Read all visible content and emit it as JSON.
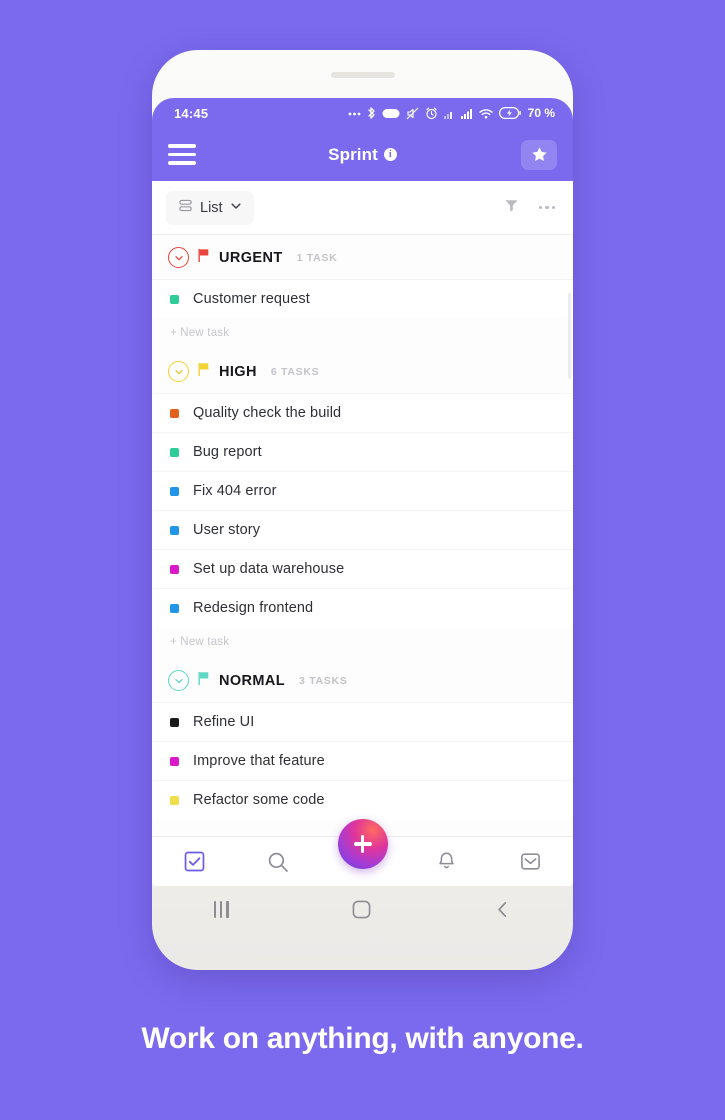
{
  "colors": {
    "background": "#7B6AEE",
    "header": "#7B6AEE",
    "urgent": "#E8453C",
    "high": "#F3D233",
    "normal": "#5FD6C4",
    "accent": "#7B6AEE"
  },
  "status_bar": {
    "time": "14:45",
    "battery_percent": "70 %",
    "icons": [
      "ellipsis-icon",
      "bluetooth-icon",
      "capsule-icon",
      "mute-icon",
      "alarm-icon",
      "signal-bars-icon",
      "signal-bars-2-icon",
      "wifi-icon",
      "battery-charging-icon"
    ]
  },
  "header": {
    "menu_icon": "hamburger-icon",
    "title": "Sprint",
    "info_badge": "i",
    "star_icon": "star-icon"
  },
  "toolbar": {
    "view_icon": "list-rows-icon",
    "view_label": "List",
    "chevron_icon": "chevron-down-icon",
    "filter_icon": "filter-funnel-icon",
    "more_icon": "more-dots-icon"
  },
  "new_task_label": "+ New task",
  "groups": [
    {
      "name": "URGENT",
      "count_label": "1 TASK",
      "color": "#E8453C",
      "tasks": [
        {
          "name": "Customer request",
          "dot": "#2ECC9B"
        }
      ]
    },
    {
      "name": "HIGH",
      "count_label": "6 TASKS",
      "color": "#F3D233",
      "tasks": [
        {
          "name": "Quality check the build",
          "dot": "#E2611C"
        },
        {
          "name": "Bug report",
          "dot": "#2ECC9B"
        },
        {
          "name": "Fix 404 error",
          "dot": "#2196E8"
        },
        {
          "name": "User story",
          "dot": "#2196E8"
        },
        {
          "name": "Set up data warehouse",
          "dot": "#D918CC"
        },
        {
          "name": "Redesign frontend",
          "dot": "#2196E8"
        }
      ]
    },
    {
      "name": "NORMAL",
      "count_label": "3 TASKS",
      "color": "#5FD6C4",
      "tasks": [
        {
          "name": "Refine UI",
          "dot": "#1A1A1A"
        },
        {
          "name": "Improve that feature",
          "dot": "#D918CC"
        },
        {
          "name": "Refactor some code",
          "dot": "#F0DE4A"
        }
      ]
    }
  ],
  "bottom_nav": {
    "items": [
      {
        "icon": "checkbox-tasks-icon",
        "active": true
      },
      {
        "icon": "search-icon",
        "active": false
      },
      {
        "icon": "bell-notifications-icon",
        "active": false
      },
      {
        "icon": "inbox-icon",
        "active": false
      }
    ],
    "fab_icon": "plus-icon"
  },
  "system_nav": {
    "recents_icon": "recents-icon",
    "home_icon": "home-icon",
    "back_icon": "back-chevron-icon"
  },
  "caption": "Work on anything, with anyone."
}
